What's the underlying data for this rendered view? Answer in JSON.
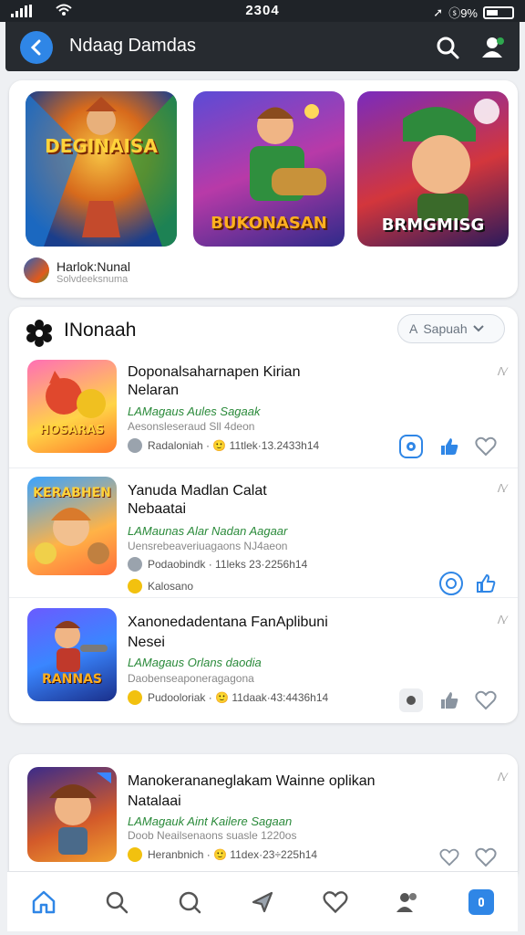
{
  "status": {
    "time": "2304",
    "battery": "ⓢ9%"
  },
  "appbar": {
    "title": "Ndaag Damdas"
  },
  "colors": {
    "accent": "#2f86e6",
    "appbar": "#272b30",
    "green": "#2a8a3a"
  },
  "featured": {
    "games": [
      {
        "title": "DEGINAISA",
        "icon": "game-art-warrior"
      },
      {
        "title": "BUKONASAN",
        "icon": "game-art-gunner"
      },
      {
        "title": "BRMGMISG",
        "icon": "game-art-soldier"
      }
    ],
    "author": "Harlok:Nunal",
    "author_meta": "Solvdeeksnuma"
  },
  "list": {
    "section_title": "INonaah",
    "sort_label": "Sapuah",
    "items": [
      {
        "title_line1": "Doponalsaharnapen Kirian",
        "title_line2": "Nelaran",
        "sub": "LAMagaus Aules Sagaak",
        "desc": "Aesonsleseraud Sll 4deon",
        "meta": "Radaloniah · 🙂 11tlek·13.2433h14",
        "thumb_title": "HOSARAS",
        "liked": true
      },
      {
        "title_line1": "Yanuda Madlan Calat",
        "title_line2": "Nebaatai",
        "sub": "LAMaunas Alar Nadan Aagaar",
        "desc": "Uensrebeaveriuagaons NJ4aeon",
        "meta": "Podaobindk · 11leks 23·2256h14",
        "meta2": "Kalosano",
        "thumb_title": "KERABHEN",
        "liked": true
      },
      {
        "title_line1": "Xanonedadentana FanAplibuni",
        "title_line2": "Nesei",
        "sub": "LAMagaus Orlans daodia",
        "desc": "Daobenseaponeragagona",
        "meta": "Pudooloriak · 🙂 11daak·43:4436h14",
        "thumb_title": "RANNAS",
        "liked": false
      }
    ]
  },
  "last": {
    "title_line1": "Manokerananeglakam Wainne oplikan",
    "title_line2": "Natalaai",
    "sub": "LAMagauk Aint Kailere Sagaan",
    "desc": "Doob Neailsenaons suasle 1220os",
    "meta": "Heranbnich · 🙂 11dex·23÷225h14"
  },
  "nav": [
    "home-icon",
    "search-icon",
    "chat-icon",
    "send-icon",
    "heart-icon",
    "people-icon",
    "app-icon"
  ]
}
